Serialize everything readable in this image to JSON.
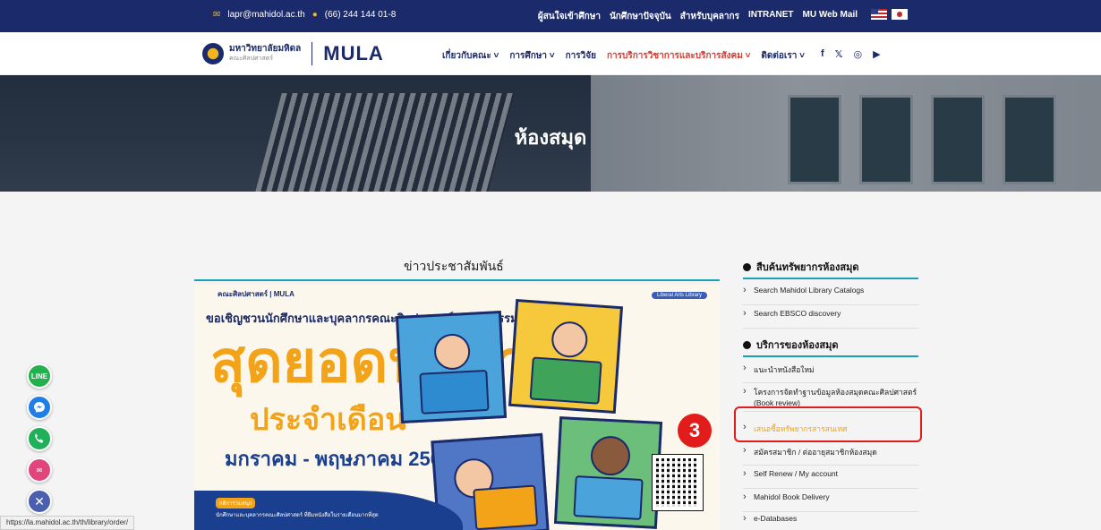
{
  "topbar": {
    "email": "lapr@mahidol.ac.th",
    "phone": "(66) 244 144 01-8",
    "links": [
      "ผู้สนใจเข้าศึกษา",
      "นักศึกษาปัจจุบัน",
      "สำหรับบุคลากร",
      "INTRANET",
      "MU Web Mail"
    ]
  },
  "nav": {
    "university": "มหาวิทยาลัยมหิดล",
    "faculty": "คณะศิลปศาสตร์",
    "brand": "MULA",
    "menu": [
      "เกี่ยวกับคณะ ˅",
      "การศึกษา ˅",
      "การวิจัย",
      "การบริการวิชาการและบริการสังคม ˅",
      "ติดต่อเรา ˅"
    ],
    "social": [
      "f",
      "𝕏",
      "◎",
      "▶"
    ]
  },
  "hero": {
    "title": "ห้องสมุด"
  },
  "news": {
    "title": "ข่าวประชาสัมพันธ์"
  },
  "poster": {
    "header": "คณะศิลปศาสตร์  |  MULA",
    "tag": "Liberal Arts Library",
    "invite": "ขอเชิญชวนนักศึกษาและบุคลากรคณะศิลปศาสตร์ ร่วมกิจกรรม",
    "headline": "สุดยอดนักอ่าน",
    "subheadline": "ประจำเดือน",
    "dates": "มกราคม - พฤษภาคม 2567",
    "join_label": "กติการ่วมสนุก",
    "join_desc": "นักศึกษาและบุคลากรคณะศิลปศาสตร์ ที่ยืมหนังสือในรายเดือนมากที่สุด"
  },
  "sidebar": {
    "section1": "สืบค้นทรัพยากรห้องสมุด",
    "section1_items": [
      "Search Mahidol Library Catalogs",
      "Search EBSCO discovery"
    ],
    "section2": "บริการของห้องสมุด",
    "section2_items": [
      "แนะนำหนังสือใหม่",
      "โครงการจัดทำฐานข้อมูลห้องสมุดคณะศิลปศาสตร์ (Book review)",
      "เสนอซื้อทรัพยากรสารสนเทศ",
      "สมัครสมาชิก / ต่ออายุสมาชิกห้องสมุด",
      "Self Renew / My account",
      "Mahidol Book Delivery",
      "e-Databases"
    ]
  },
  "annotation": {
    "step": "3"
  },
  "chat": [
    "LINE",
    "✉"
  ],
  "statusbar": {
    "url": "https://la.mahidol.ac.th/th/library/order/"
  },
  "colors": {
    "navy": "#1b2a6b",
    "accent": "#17a2b8",
    "orange": "#f2a318",
    "red": "#e21b1b"
  }
}
